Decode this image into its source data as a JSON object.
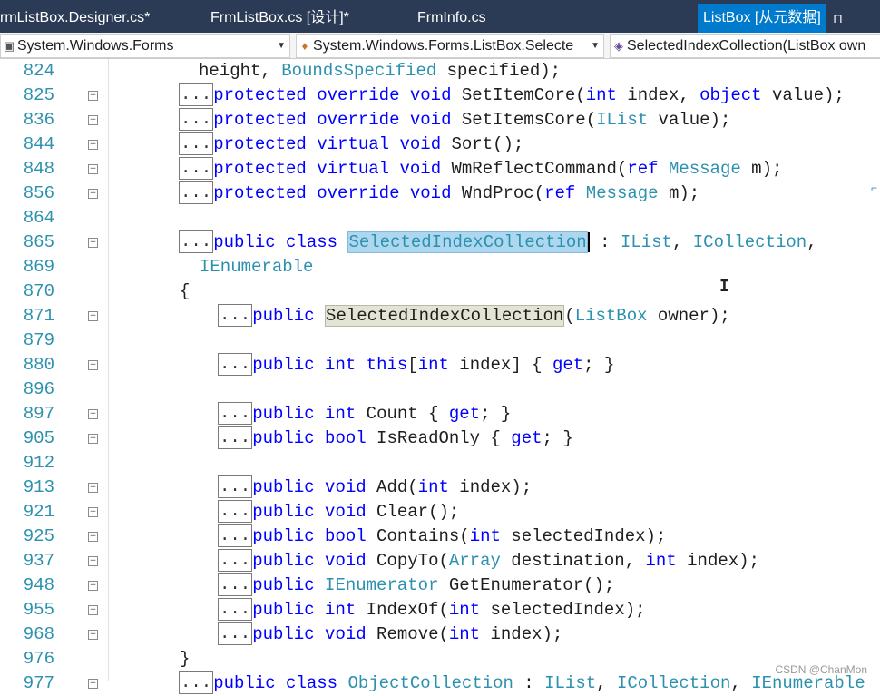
{
  "tabs": [
    {
      "label": "rmListBox.Designer.cs*",
      "active": false
    },
    {
      "label": "FrmListBox.cs [设计]*",
      "active": false
    },
    {
      "label": "FrmInfo.cs",
      "active": false
    },
    {
      "label": "ListBox [从元数据]",
      "active": true
    }
  ],
  "tab_pin_icon": "pin-icon",
  "nav": {
    "project": "System.Windows.Forms",
    "type": "System.Windows.Forms.ListBox.Selecte",
    "member": "SelectedIndexCollection(ListBox own"
  },
  "lines": [
    {
      "n": "824",
      "indent": 1,
      "fold": false,
      "collapsed": false,
      "tokens": [
        {
          "t": "height, "
        },
        {
          "t": "BoundsSpecified",
          "c": "ty"
        },
        {
          "t": " specified);"
        }
      ]
    },
    {
      "n": "825",
      "indent": 0,
      "fold": true,
      "collapsed": true,
      "tokens": [
        {
          "t": "protected",
          "c": "kw"
        },
        {
          "t": " "
        },
        {
          "t": "override",
          "c": "kw"
        },
        {
          "t": " "
        },
        {
          "t": "void",
          "c": "kw"
        },
        {
          "t": " SetItemCore("
        },
        {
          "t": "int",
          "c": "kw"
        },
        {
          "t": " index, "
        },
        {
          "t": "object",
          "c": "kw"
        },
        {
          "t": " value);"
        }
      ]
    },
    {
      "n": "836",
      "indent": 0,
      "fold": true,
      "collapsed": true,
      "tokens": [
        {
          "t": "protected",
          "c": "kw"
        },
        {
          "t": " "
        },
        {
          "t": "override",
          "c": "kw"
        },
        {
          "t": " "
        },
        {
          "t": "void",
          "c": "kw"
        },
        {
          "t": " SetItemsCore("
        },
        {
          "t": "IList",
          "c": "ty"
        },
        {
          "t": " value);"
        }
      ]
    },
    {
      "n": "844",
      "indent": 0,
      "fold": true,
      "collapsed": true,
      "tokens": [
        {
          "t": "protected",
          "c": "kw"
        },
        {
          "t": " "
        },
        {
          "t": "virtual",
          "c": "kw"
        },
        {
          "t": " "
        },
        {
          "t": "void",
          "c": "kw"
        },
        {
          "t": " Sort();"
        }
      ]
    },
    {
      "n": "848",
      "indent": 0,
      "fold": true,
      "collapsed": true,
      "tokens": [
        {
          "t": "protected",
          "c": "kw"
        },
        {
          "t": " "
        },
        {
          "t": "virtual",
          "c": "kw"
        },
        {
          "t": " "
        },
        {
          "t": "void",
          "c": "kw"
        },
        {
          "t": " WmReflectCommand("
        },
        {
          "t": "ref",
          "c": "kw"
        },
        {
          "t": " "
        },
        {
          "t": "Message",
          "c": "ty"
        },
        {
          "t": " m);"
        }
      ]
    },
    {
      "n": "856",
      "indent": 0,
      "fold": true,
      "collapsed": true,
      "tokens": [
        {
          "t": "protected",
          "c": "kw"
        },
        {
          "t": " "
        },
        {
          "t": "override",
          "c": "kw"
        },
        {
          "t": " "
        },
        {
          "t": "void",
          "c": "kw"
        },
        {
          "t": " WndProc("
        },
        {
          "t": "ref",
          "c": "kw"
        },
        {
          "t": " "
        },
        {
          "t": "Message",
          "c": "ty"
        },
        {
          "t": " m);"
        }
      ]
    },
    {
      "n": "864",
      "indent": 0,
      "fold": false,
      "collapsed": false,
      "tokens": []
    },
    {
      "n": "865",
      "indent": 0,
      "fold": true,
      "collapsed": true,
      "tokens": [
        {
          "t": "public",
          "c": "kw"
        },
        {
          "t": " "
        },
        {
          "t": "class",
          "c": "kw"
        },
        {
          "t": " "
        },
        {
          "t": "SelectedIndexCollection",
          "c": "ty",
          "hl": "sel"
        },
        {
          "t": " : "
        },
        {
          "t": "IList",
          "c": "ty"
        },
        {
          "t": ", "
        },
        {
          "t": "ICollection",
          "c": "ty"
        },
        {
          "t": ","
        }
      ]
    },
    {
      "n": "869",
      "indent": 2,
      "fold": false,
      "collapsed": false,
      "tokens": [
        {
          "t": "IEnumerable",
          "c": "ty"
        }
      ]
    },
    {
      "n": "870",
      "indent": 3,
      "fold": false,
      "collapsed": false,
      "tokens": [
        {
          "t": "{"
        }
      ]
    },
    {
      "n": "871",
      "indent": 4,
      "fold": true,
      "collapsed": true,
      "tokens": [
        {
          "t": "public",
          "c": "kw"
        },
        {
          "t": " "
        },
        {
          "t": "SelectedIndexCollection",
          "hl": "ref"
        },
        {
          "t": "("
        },
        {
          "t": "ListBox",
          "c": "ty"
        },
        {
          "t": " owner);"
        }
      ]
    },
    {
      "n": "879",
      "indent": 4,
      "fold": false,
      "collapsed": false,
      "tokens": []
    },
    {
      "n": "880",
      "indent": 4,
      "fold": true,
      "collapsed": true,
      "tokens": [
        {
          "t": "public",
          "c": "kw"
        },
        {
          "t": " "
        },
        {
          "t": "int",
          "c": "kw"
        },
        {
          "t": " "
        },
        {
          "t": "this",
          "c": "kw"
        },
        {
          "t": "["
        },
        {
          "t": "int",
          "c": "kw"
        },
        {
          "t": " index] { "
        },
        {
          "t": "get",
          "c": "kw"
        },
        {
          "t": "; }"
        }
      ]
    },
    {
      "n": "896",
      "indent": 4,
      "fold": false,
      "collapsed": false,
      "tokens": []
    },
    {
      "n": "897",
      "indent": 4,
      "fold": true,
      "collapsed": true,
      "tokens": [
        {
          "t": "public",
          "c": "kw"
        },
        {
          "t": " "
        },
        {
          "t": "int",
          "c": "kw"
        },
        {
          "t": " Count { "
        },
        {
          "t": "get",
          "c": "kw"
        },
        {
          "t": "; }"
        }
      ]
    },
    {
      "n": "905",
      "indent": 4,
      "fold": true,
      "collapsed": true,
      "tokens": [
        {
          "t": "public",
          "c": "kw"
        },
        {
          "t": " "
        },
        {
          "t": "bool",
          "c": "kw"
        },
        {
          "t": " IsReadOnly { "
        },
        {
          "t": "get",
          "c": "kw"
        },
        {
          "t": "; }"
        }
      ]
    },
    {
      "n": "912",
      "indent": 4,
      "fold": false,
      "collapsed": false,
      "tokens": []
    },
    {
      "n": "913",
      "indent": 4,
      "fold": true,
      "collapsed": true,
      "tokens": [
        {
          "t": "public",
          "c": "kw"
        },
        {
          "t": " "
        },
        {
          "t": "void",
          "c": "kw"
        },
        {
          "t": " Add("
        },
        {
          "t": "int",
          "c": "kw"
        },
        {
          "t": " index);"
        }
      ]
    },
    {
      "n": "921",
      "indent": 4,
      "fold": true,
      "collapsed": true,
      "tokens": [
        {
          "t": "public",
          "c": "kw"
        },
        {
          "t": " "
        },
        {
          "t": "void",
          "c": "kw"
        },
        {
          "t": " Clear();"
        }
      ]
    },
    {
      "n": "925",
      "indent": 4,
      "fold": true,
      "collapsed": true,
      "tokens": [
        {
          "t": "public",
          "c": "kw"
        },
        {
          "t": " "
        },
        {
          "t": "bool",
          "c": "kw"
        },
        {
          "t": " Contains("
        },
        {
          "t": "int",
          "c": "kw"
        },
        {
          "t": " selectedIndex);"
        }
      ]
    },
    {
      "n": "937",
      "indent": 4,
      "fold": true,
      "collapsed": true,
      "tokens": [
        {
          "t": "public",
          "c": "kw"
        },
        {
          "t": " "
        },
        {
          "t": "void",
          "c": "kw"
        },
        {
          "t": " CopyTo("
        },
        {
          "t": "Array",
          "c": "ty"
        },
        {
          "t": " destination, "
        },
        {
          "t": "int",
          "c": "kw"
        },
        {
          "t": " index);"
        }
      ]
    },
    {
      "n": "948",
      "indent": 4,
      "fold": true,
      "collapsed": true,
      "tokens": [
        {
          "t": "public",
          "c": "kw"
        },
        {
          "t": " "
        },
        {
          "t": "IEnumerator",
          "c": "ty"
        },
        {
          "t": " GetEnumerator();"
        }
      ]
    },
    {
      "n": "955",
      "indent": 4,
      "fold": true,
      "collapsed": true,
      "tokens": [
        {
          "t": "public",
          "c": "kw"
        },
        {
          "t": " "
        },
        {
          "t": "int",
          "c": "kw"
        },
        {
          "t": " IndexOf("
        },
        {
          "t": "int",
          "c": "kw"
        },
        {
          "t": " selectedIndex);"
        }
      ]
    },
    {
      "n": "968",
      "indent": 4,
      "fold": true,
      "collapsed": true,
      "tokens": [
        {
          "t": "public",
          "c": "kw"
        },
        {
          "t": " "
        },
        {
          "t": "void",
          "c": "kw"
        },
        {
          "t": " Remove("
        },
        {
          "t": "int",
          "c": "kw"
        },
        {
          "t": " index);"
        }
      ]
    },
    {
      "n": "976",
      "indent": 3,
      "fold": false,
      "collapsed": false,
      "tokens": [
        {
          "t": "}"
        }
      ]
    },
    {
      "n": "977",
      "indent": 0,
      "fold": true,
      "collapsed": true,
      "tokens": [
        {
          "t": "public",
          "c": "kw"
        },
        {
          "t": " "
        },
        {
          "t": "class",
          "c": "kw"
        },
        {
          "t": " "
        },
        {
          "t": "ObjectCollection",
          "c": "ty"
        },
        {
          "t": " : "
        },
        {
          "t": "IList",
          "c": "ty"
        },
        {
          "t": ", "
        },
        {
          "t": "ICollection",
          "c": "ty"
        },
        {
          "t": ", "
        },
        {
          "t": "IEnumerable",
          "c": "ty"
        }
      ]
    }
  ],
  "collapsed_label": "...",
  "watermark": "CSDN @ChanMon",
  "colors": {
    "keyword": "#0000ff",
    "type": "#2b91af",
    "line_number": "#2b91af",
    "active_tab": "#007acc",
    "tab_bar": "#2b3a55",
    "selection": "#add6ef"
  }
}
